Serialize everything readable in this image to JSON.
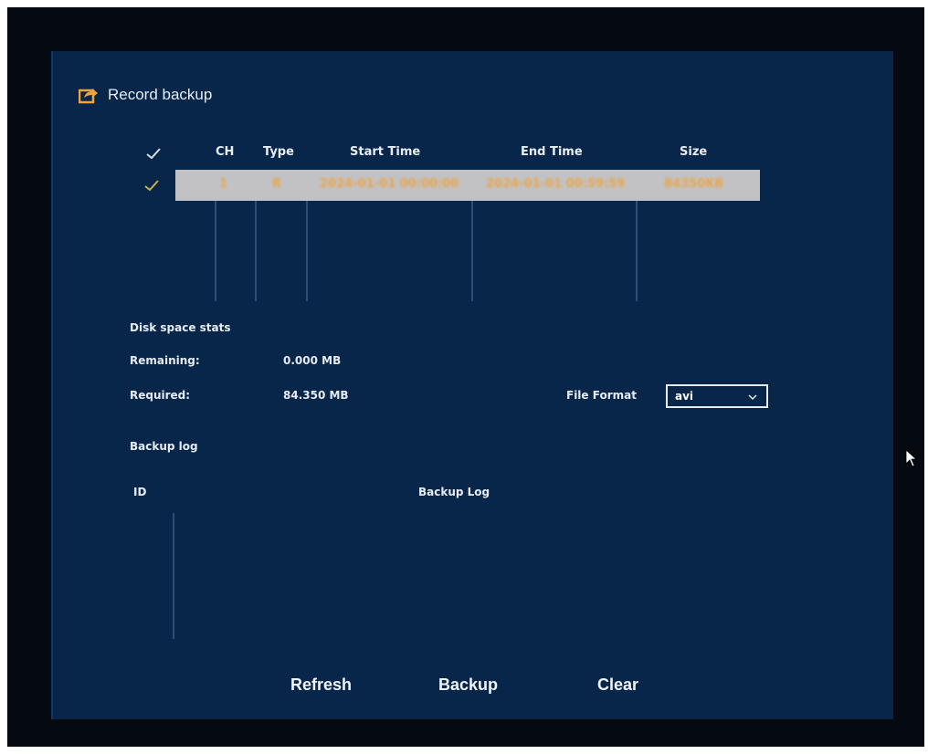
{
  "window": {
    "title": "Record backup",
    "title_icon": "export-icon"
  },
  "record_table": {
    "headers": {
      "check": "✓",
      "ch": "CH",
      "type": "Type",
      "start_time": "Start Time",
      "end_time": "End Time",
      "size": "Size"
    },
    "rows": [
      {
        "checked": true,
        "ch": "1",
        "type": "R",
        "start_time": "2024-01-01 00:00:00",
        "end_time": "2024-01-01 00:59:59",
        "size": "84350KB"
      }
    ],
    "highlight_color": "#c2c2c4",
    "text_color": "#e9a64b",
    "check_color": "#c9b14a"
  },
  "disk_space": {
    "heading": "Disk space stats",
    "remaining_label": "Remaining:",
    "remaining_value": "0.000 MB",
    "required_label": "Required:",
    "required_value": "84.350 MB"
  },
  "file_format": {
    "label": "File Format",
    "selected": "avi"
  },
  "backup_log": {
    "heading": "Backup log",
    "col_id": "ID",
    "col_log": "Backup Log"
  },
  "buttons": {
    "refresh": "Refresh",
    "backup": "Backup",
    "clear": "Clear"
  },
  "colors": {
    "panel_bg": "#07264a",
    "outer_bg": "#050a10",
    "accent_orange": "#f2a33a"
  }
}
